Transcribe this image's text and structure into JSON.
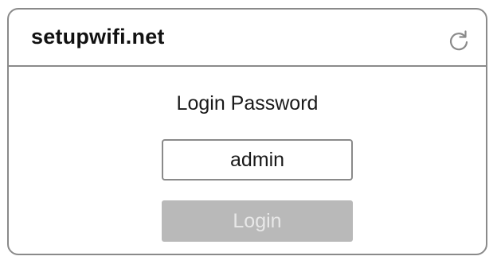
{
  "window": {
    "title": "setupwifi.net",
    "refresh_icon": "refresh-icon"
  },
  "login": {
    "label": "Login Password",
    "password_value": "admin",
    "button_label": "Login"
  },
  "colors": {
    "border": "#8a8a8a",
    "button_bg": "#b9b9b9",
    "button_text": "#e8e8e8"
  }
}
